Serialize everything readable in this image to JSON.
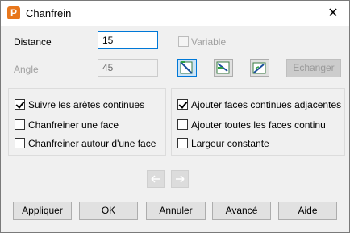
{
  "window": {
    "title": "Chanfrein",
    "close_symbol": "✕",
    "app_icon_letter": "P"
  },
  "distance": {
    "label": "Distance",
    "value": "15"
  },
  "variable": {
    "label": "Variable",
    "checked": false,
    "enabled": false
  },
  "angle": {
    "label": "Angle",
    "value": "45",
    "enabled": false
  },
  "swap_button": {
    "label": "Echanger",
    "enabled": false
  },
  "chamfer_type_icons": [
    "chamfer-distance-icon",
    "chamfer-two-distances-icon",
    "chamfer-distance-angle-icon"
  ],
  "left_options": [
    {
      "label": "Suivre les arêtes continues",
      "checked": true
    },
    {
      "label": "Chanfreiner une face",
      "checked": false
    },
    {
      "label": "Chanfreiner autour d'une face",
      "checked": false
    }
  ],
  "right_options": [
    {
      "label": "Ajouter faces continues adjacentes",
      "checked": true
    },
    {
      "label": "Ajouter toutes les faces continu",
      "checked": false
    },
    {
      "label": "Largeur constante",
      "checked": false
    }
  ],
  "buttons": {
    "apply": "Appliquer",
    "ok": "OK",
    "cancel": "Annuler",
    "advanced": "Avancé",
    "help": "Aide"
  },
  "colors": {
    "accent": "#0078d7",
    "app_icon": "#e8771c"
  }
}
